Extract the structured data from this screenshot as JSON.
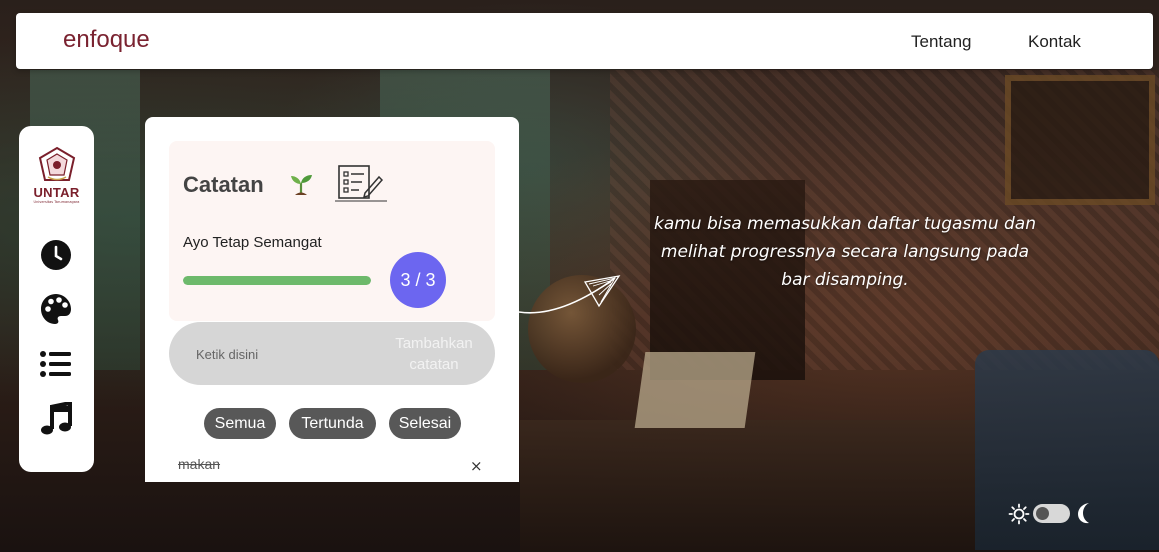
{
  "navbar": {
    "brand": "enfoque",
    "links": [
      "Tentang",
      "Kontak"
    ]
  },
  "sidebar": {
    "logo_text": "UNTAR",
    "logo_subtext": "Universitas Tarumanagara",
    "items": [
      {
        "icon": "clock-icon"
      },
      {
        "icon": "palette-icon"
      },
      {
        "icon": "list-icon"
      },
      {
        "icon": "music-icon"
      }
    ]
  },
  "todo": {
    "title": "Catatan",
    "subtitle": "Ayo Tetap Semangat",
    "progress_text": "3 / 3",
    "progress_fraction": 1.0,
    "input_placeholder": "Ketik disini",
    "add_button": "Tambahkan catatan",
    "filters": [
      "Semua",
      "Tertunda",
      "Selesai"
    ],
    "items": [
      {
        "text": "makan",
        "done": true
      }
    ],
    "delete_symbol": "×"
  },
  "hint": {
    "line1": "kamu bisa memasukkan daftar tugasmu dan",
    "line2": "melihat  progressnya secara langsung pada",
    "line3": "bar disamping."
  },
  "colors": {
    "brand": "#7a2230",
    "progress": "#6db96b",
    "progress_circle": "#6c66f0",
    "filter_button": "#585858"
  }
}
